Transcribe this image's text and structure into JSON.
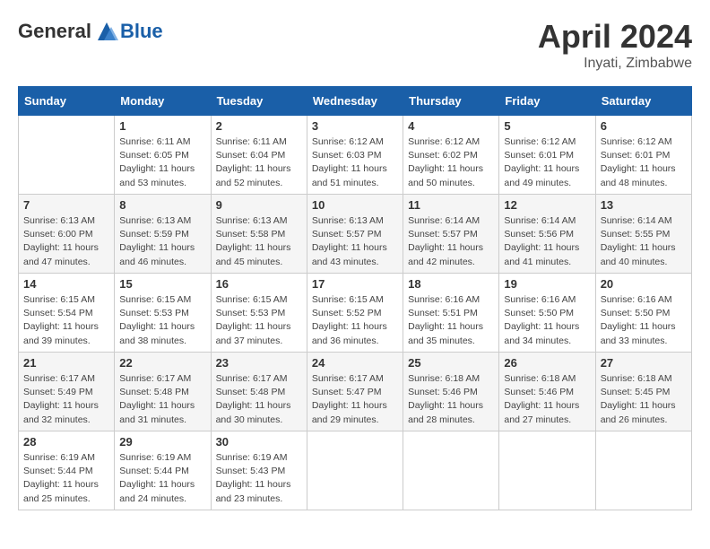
{
  "header": {
    "logo_general": "General",
    "logo_blue": "Blue",
    "month": "April 2024",
    "location": "Inyati, Zimbabwe"
  },
  "columns": [
    "Sunday",
    "Monday",
    "Tuesday",
    "Wednesday",
    "Thursday",
    "Friday",
    "Saturday"
  ],
  "weeks": [
    [
      {
        "day": "",
        "info": ""
      },
      {
        "day": "1",
        "info": "Sunrise: 6:11 AM\nSunset: 6:05 PM\nDaylight: 11 hours\nand 53 minutes."
      },
      {
        "day": "2",
        "info": "Sunrise: 6:11 AM\nSunset: 6:04 PM\nDaylight: 11 hours\nand 52 minutes."
      },
      {
        "day": "3",
        "info": "Sunrise: 6:12 AM\nSunset: 6:03 PM\nDaylight: 11 hours\nand 51 minutes."
      },
      {
        "day": "4",
        "info": "Sunrise: 6:12 AM\nSunset: 6:02 PM\nDaylight: 11 hours\nand 50 minutes."
      },
      {
        "day": "5",
        "info": "Sunrise: 6:12 AM\nSunset: 6:01 PM\nDaylight: 11 hours\nand 49 minutes."
      },
      {
        "day": "6",
        "info": "Sunrise: 6:12 AM\nSunset: 6:01 PM\nDaylight: 11 hours\nand 48 minutes."
      }
    ],
    [
      {
        "day": "7",
        "info": "Sunrise: 6:13 AM\nSunset: 6:00 PM\nDaylight: 11 hours\nand 47 minutes."
      },
      {
        "day": "8",
        "info": "Sunrise: 6:13 AM\nSunset: 5:59 PM\nDaylight: 11 hours\nand 46 minutes."
      },
      {
        "day": "9",
        "info": "Sunrise: 6:13 AM\nSunset: 5:58 PM\nDaylight: 11 hours\nand 45 minutes."
      },
      {
        "day": "10",
        "info": "Sunrise: 6:13 AM\nSunset: 5:57 PM\nDaylight: 11 hours\nand 43 minutes."
      },
      {
        "day": "11",
        "info": "Sunrise: 6:14 AM\nSunset: 5:57 PM\nDaylight: 11 hours\nand 42 minutes."
      },
      {
        "day": "12",
        "info": "Sunrise: 6:14 AM\nSunset: 5:56 PM\nDaylight: 11 hours\nand 41 minutes."
      },
      {
        "day": "13",
        "info": "Sunrise: 6:14 AM\nSunset: 5:55 PM\nDaylight: 11 hours\nand 40 minutes."
      }
    ],
    [
      {
        "day": "14",
        "info": "Sunrise: 6:15 AM\nSunset: 5:54 PM\nDaylight: 11 hours\nand 39 minutes."
      },
      {
        "day": "15",
        "info": "Sunrise: 6:15 AM\nSunset: 5:53 PM\nDaylight: 11 hours\nand 38 minutes."
      },
      {
        "day": "16",
        "info": "Sunrise: 6:15 AM\nSunset: 5:53 PM\nDaylight: 11 hours\nand 37 minutes."
      },
      {
        "day": "17",
        "info": "Sunrise: 6:15 AM\nSunset: 5:52 PM\nDaylight: 11 hours\nand 36 minutes."
      },
      {
        "day": "18",
        "info": "Sunrise: 6:16 AM\nSunset: 5:51 PM\nDaylight: 11 hours\nand 35 minutes."
      },
      {
        "day": "19",
        "info": "Sunrise: 6:16 AM\nSunset: 5:50 PM\nDaylight: 11 hours\nand 34 minutes."
      },
      {
        "day": "20",
        "info": "Sunrise: 6:16 AM\nSunset: 5:50 PM\nDaylight: 11 hours\nand 33 minutes."
      }
    ],
    [
      {
        "day": "21",
        "info": "Sunrise: 6:17 AM\nSunset: 5:49 PM\nDaylight: 11 hours\nand 32 minutes."
      },
      {
        "day": "22",
        "info": "Sunrise: 6:17 AM\nSunset: 5:48 PM\nDaylight: 11 hours\nand 31 minutes."
      },
      {
        "day": "23",
        "info": "Sunrise: 6:17 AM\nSunset: 5:48 PM\nDaylight: 11 hours\nand 30 minutes."
      },
      {
        "day": "24",
        "info": "Sunrise: 6:17 AM\nSunset: 5:47 PM\nDaylight: 11 hours\nand 29 minutes."
      },
      {
        "day": "25",
        "info": "Sunrise: 6:18 AM\nSunset: 5:46 PM\nDaylight: 11 hours\nand 28 minutes."
      },
      {
        "day": "26",
        "info": "Sunrise: 6:18 AM\nSunset: 5:46 PM\nDaylight: 11 hours\nand 27 minutes."
      },
      {
        "day": "27",
        "info": "Sunrise: 6:18 AM\nSunset: 5:45 PM\nDaylight: 11 hours\nand 26 minutes."
      }
    ],
    [
      {
        "day": "28",
        "info": "Sunrise: 6:19 AM\nSunset: 5:44 PM\nDaylight: 11 hours\nand 25 minutes."
      },
      {
        "day": "29",
        "info": "Sunrise: 6:19 AM\nSunset: 5:44 PM\nDaylight: 11 hours\nand 24 minutes."
      },
      {
        "day": "30",
        "info": "Sunrise: 6:19 AM\nSunset: 5:43 PM\nDaylight: 11 hours\nand 23 minutes."
      },
      {
        "day": "",
        "info": ""
      },
      {
        "day": "",
        "info": ""
      },
      {
        "day": "",
        "info": ""
      },
      {
        "day": "",
        "info": ""
      }
    ]
  ]
}
